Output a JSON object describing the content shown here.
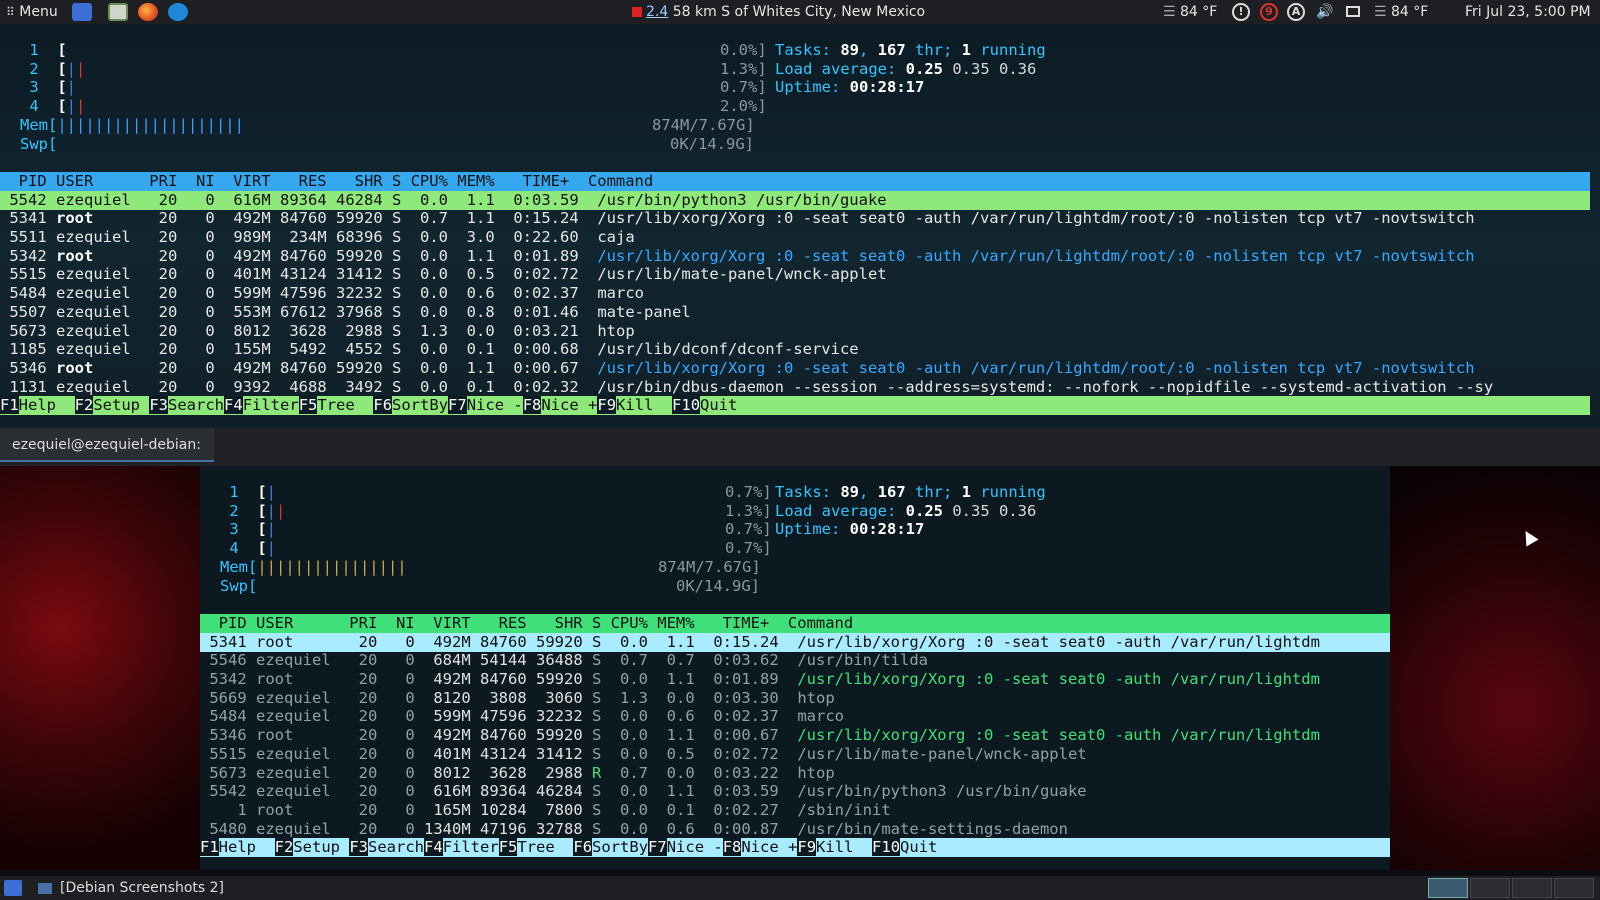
{
  "top_panel": {
    "menu_label": "Menu",
    "weather_notice": "2.4",
    "location": "58 km S of Whites City, New Mexico",
    "temp1": "84 °F",
    "temp2": "84 °F",
    "clock": "Fri Jul 23, 5:00 PM",
    "tray_badge": "9",
    "tray_a": "A",
    "tray_i": "!"
  },
  "guake": {
    "cpus": [
      {
        "n": "1",
        "pct": "0.0%]",
        "bar": ""
      },
      {
        "n": "2",
        "pct": "1.3%]",
        "bar": "||"
      },
      {
        "n": "3",
        "pct": "0.7%]",
        "bar": "|"
      },
      {
        "n": "4",
        "pct": "2.0%]",
        "bar": "||"
      }
    ],
    "mem_label": "Mem[",
    "mem_bar": "||||||||||||||||||||",
    "mem_val": "874M/7.67G]",
    "swp_label": "Swp[",
    "swp_val": "0K/14.9G]",
    "tasks_label": "Tasks: ",
    "tasks_n": "89",
    "tasks_thr": "167",
    "tasks_thr_suffix": " thr; ",
    "tasks_running": "1",
    "tasks_running_suffix": " running",
    "load_label": "Load average: ",
    "load1": "0.25",
    "load5": "0.35",
    "load15": "0.36",
    "uptime_label": "Uptime: ",
    "uptime": "00:28:17",
    "header": "  PID USER      PRI  NI  VIRT   RES   SHR S CPU% MEM%   TIME+  Command",
    "rows": [
      {
        "pid": "5542",
        "user": "ezequiel",
        "pri": "20",
        "ni": "0",
        "virt": "616M",
        "res": "89364",
        "shr": "46284",
        "s": "S",
        "cpu": "0.0",
        "mem": "1.1",
        "time": "0:03.59",
        "cmd": "/usr/bin/python3 /usr/bin/guake",
        "sel": true
      },
      {
        "pid": "5341",
        "user": "root",
        "pri": "20",
        "ni": "0",
        "virt": "492M",
        "res": "84760",
        "shr": "59920",
        "s": "S",
        "cpu": "0.7",
        "mem": "1.1",
        "time": "0:15.24",
        "cmd": "/usr/lib/xorg/Xorg :0 -seat seat0 -auth /var/run/lightdm/root/:0 -nolisten tcp vt7 -novtswitch"
      },
      {
        "pid": "5511",
        "user": "ezequiel",
        "pri": "20",
        "ni": "0",
        "virt": "989M",
        "res": "234M",
        "shr": "68396",
        "s": "S",
        "cpu": "0.0",
        "mem": "3.0",
        "time": "0:22.60",
        "cmd": "caja"
      },
      {
        "pid": "5342",
        "user": "root",
        "pri": "20",
        "ni": "0",
        "virt": "492M",
        "res": "84760",
        "shr": "59920",
        "s": "S",
        "cpu": "0.0",
        "mem": "1.1",
        "time": "0:01.89",
        "cmd": "/usr/lib/xorg/Xorg :0 -seat seat0 -auth /var/run/lightdm/root/:0 -nolisten tcp vt7 -novtswitch",
        "thread": true
      },
      {
        "pid": "5515",
        "user": "ezequiel",
        "pri": "20",
        "ni": "0",
        "virt": "401M",
        "res": "43124",
        "shr": "31412",
        "s": "S",
        "cpu": "0.0",
        "mem": "0.5",
        "time": "0:02.72",
        "cmd": "/usr/lib/mate-panel/wnck-applet"
      },
      {
        "pid": "5484",
        "user": "ezequiel",
        "pri": "20",
        "ni": "0",
        "virt": "599M",
        "res": "47596",
        "shr": "32232",
        "s": "S",
        "cpu": "0.0",
        "mem": "0.6",
        "time": "0:02.37",
        "cmd": "marco"
      },
      {
        "pid": "5507",
        "user": "ezequiel",
        "pri": "20",
        "ni": "0",
        "virt": "553M",
        "res": "67612",
        "shr": "37968",
        "s": "S",
        "cpu": "0.0",
        "mem": "0.8",
        "time": "0:01.46",
        "cmd": "mate-panel"
      },
      {
        "pid": "5673",
        "user": "ezequiel",
        "pri": "20",
        "ni": "0",
        "virt": "8012",
        "res": "3628",
        "shr": "2988",
        "s": "S",
        "cpu": "1.3",
        "mem": "0.0",
        "time": "0:03.21",
        "cmd": "htop"
      },
      {
        "pid": "1185",
        "user": "ezequiel",
        "pri": "20",
        "ni": "0",
        "virt": "155M",
        "res": "5492",
        "shr": "4552",
        "s": "S",
        "cpu": "0.0",
        "mem": "0.1",
        "time": "0:00.68",
        "cmd": "/usr/lib/dconf/dconf-service"
      },
      {
        "pid": "5346",
        "user": "root",
        "pri": "20",
        "ni": "0",
        "virt": "492M",
        "res": "84760",
        "shr": "59920",
        "s": "S",
        "cpu": "0.0",
        "mem": "1.1",
        "time": "0:00.67",
        "cmd": "/usr/lib/xorg/Xorg :0 -seat seat0 -auth /var/run/lightdm/root/:0 -nolisten tcp vt7 -novtswitch",
        "thread": true
      },
      {
        "pid": "1131",
        "user": "ezequiel",
        "pri": "20",
        "ni": "0",
        "virt": "9392",
        "res": "4688",
        "shr": "3492",
        "s": "S",
        "cpu": "0.0",
        "mem": "0.1",
        "time": "0:02.32",
        "cmd": "/usr/bin/dbus-daemon --session --address=systemd: --nofork --nopidfile --systemd-activation --sy"
      }
    ],
    "fkeys": [
      {
        "k": "F1",
        "l": "Help  "
      },
      {
        "k": "F2",
        "l": "Setup "
      },
      {
        "k": "F3",
        "l": "Search"
      },
      {
        "k": "F4",
        "l": "Filter"
      },
      {
        "k": "F5",
        "l": "Tree  "
      },
      {
        "k": "F6",
        "l": "SortBy"
      },
      {
        "k": "F7",
        "l": "Nice -"
      },
      {
        "k": "F8",
        "l": "Nice +"
      },
      {
        "k": "F9",
        "l": "Kill  "
      },
      {
        "k": "F10",
        "l": "Quit  "
      }
    ],
    "accent_header": "#35a8f0",
    "accent_select": "#8fe97a"
  },
  "tab": {
    "title": "ezequiel@ezequiel-debian: ~"
  },
  "tilda": {
    "cpus": [
      {
        "n": "1",
        "pct": "0.7%]",
        "bar": "|"
      },
      {
        "n": "2",
        "pct": "1.3%]",
        "bar": "||"
      },
      {
        "n": "3",
        "pct": "0.7%]",
        "bar": "|"
      },
      {
        "n": "4",
        "pct": "0.7%]",
        "bar": "|"
      }
    ],
    "mem_label": "Mem[",
    "mem_bar": "||||||||||||||||",
    "mem_val": "874M/7.67G]",
    "swp_label": "Swp[",
    "swp_val": "0K/14.9G]",
    "tasks_label": "Tasks: ",
    "tasks_n": "89",
    "tasks_thr": "167",
    "tasks_thr_suffix": " thr; ",
    "tasks_running": "1",
    "tasks_running_suffix": " running",
    "load_label": "Load average: ",
    "load1": "0.25",
    "load5": "0.35",
    "load15": "0.36",
    "uptime_label": "Uptime: ",
    "uptime": "00:28:17",
    "header": "  PID USER      PRI  NI  VIRT   RES   SHR S CPU% MEM%   TIME+  Command",
    "rows": [
      {
        "pid": "5341",
        "user": "root",
        "pri": "20",
        "ni": "0",
        "virt": "492M",
        "res": "84760",
        "shr": "59920",
        "s": "S",
        "cpu": "0.0",
        "mem": "1.1",
        "time": "0:15.24",
        "cmd": "/usr/lib/xorg/Xorg :0 -seat seat0 -auth /var/run/lightdm",
        "sel": true
      },
      {
        "pid": "5546",
        "user": "ezequiel",
        "pri": "20",
        "ni": "0",
        "virt": "684M",
        "res": "54144",
        "shr": "36488",
        "s": "S",
        "cpu": "0.7",
        "mem": "0.7",
        "time": "0:03.62",
        "cmd": "/usr/bin/tilda"
      },
      {
        "pid": "5342",
        "user": "root",
        "pri": "20",
        "ni": "0",
        "virt": "492M",
        "res": "84760",
        "shr": "59920",
        "s": "S",
        "cpu": "0.0",
        "mem": "1.1",
        "time": "0:01.89",
        "cmd": "/usr/lib/xorg/Xorg :0 -seat seat0 -auth /var/run/lightdm",
        "thread": true
      },
      {
        "pid": "5669",
        "user": "ezequiel",
        "pri": "20",
        "ni": "0",
        "virt": "8120",
        "res": "3808",
        "shr": "3060",
        "s": "S",
        "cpu": "1.3",
        "mem": "0.0",
        "time": "0:03.30",
        "cmd": "htop"
      },
      {
        "pid": "5484",
        "user": "ezequiel",
        "pri": "20",
        "ni": "0",
        "virt": "599M",
        "res": "47596",
        "shr": "32232",
        "s": "S",
        "cpu": "0.0",
        "mem": "0.6",
        "time": "0:02.37",
        "cmd": "marco"
      },
      {
        "pid": "5346",
        "user": "root",
        "pri": "20",
        "ni": "0",
        "virt": "492M",
        "res": "84760",
        "shr": "59920",
        "s": "S",
        "cpu": "0.0",
        "mem": "1.1",
        "time": "0:00.67",
        "cmd": "/usr/lib/xorg/Xorg :0 -seat seat0 -auth /var/run/lightdm",
        "thread": true
      },
      {
        "pid": "5515",
        "user": "ezequiel",
        "pri": "20",
        "ni": "0",
        "virt": "401M",
        "res": "43124",
        "shr": "31412",
        "s": "S",
        "cpu": "0.0",
        "mem": "0.5",
        "time": "0:02.72",
        "cmd": "/usr/lib/mate-panel/wnck-applet"
      },
      {
        "pid": "5673",
        "user": "ezequiel",
        "pri": "20",
        "ni": "0",
        "virt": "8012",
        "res": "3628",
        "shr": "2988",
        "s": "R",
        "cpu": "0.7",
        "mem": "0.0",
        "time": "0:03.22",
        "cmd": "htop"
      },
      {
        "pid": "5542",
        "user": "ezequiel",
        "pri": "20",
        "ni": "0",
        "virt": "616M",
        "res": "89364",
        "shr": "46284",
        "s": "S",
        "cpu": "0.0",
        "mem": "1.1",
        "time": "0:03.59",
        "cmd": "/usr/bin/python3 /usr/bin/guake"
      },
      {
        "pid": "1",
        "user": "root",
        "pri": "20",
        "ni": "0",
        "virt": "165M",
        "res": "10284",
        "shr": "7800",
        "s": "S",
        "cpu": "0.0",
        "mem": "0.1",
        "time": "0:02.27",
        "cmd": "/sbin/init"
      },
      {
        "pid": "5480",
        "user": "ezequiel",
        "pri": "20",
        "ni": "0",
        "virt": "1340M",
        "res": "47196",
        "shr": "32788",
        "s": "S",
        "cpu": "0.0",
        "mem": "0.6",
        "time": "0:00.87",
        "cmd": "/usr/bin/mate-settings-daemon"
      }
    ],
    "fkeys": [
      {
        "k": "F1",
        "l": "Help  "
      },
      {
        "k": "F2",
        "l": "Setup "
      },
      {
        "k": "F3",
        "l": "Search"
      },
      {
        "k": "F4",
        "l": "Filter"
      },
      {
        "k": "F5",
        "l": "Tree  "
      },
      {
        "k": "F6",
        "l": "SortBy"
      },
      {
        "k": "F7",
        "l": "Nice -"
      },
      {
        "k": "F8",
        "l": "Nice +"
      },
      {
        "k": "F9",
        "l": "Kill  "
      },
      {
        "k": "F10",
        "l": "Quit  "
      }
    ],
    "accent_header": "#3fe07a",
    "accent_select": "#a9ecff"
  },
  "bottom_panel": {
    "task_label": "[Debian Screenshots 2]"
  },
  "colors": {
    "panel": "#1d1f22",
    "terminal_bg": "#10212b",
    "desktop_red": "#c0101e"
  }
}
